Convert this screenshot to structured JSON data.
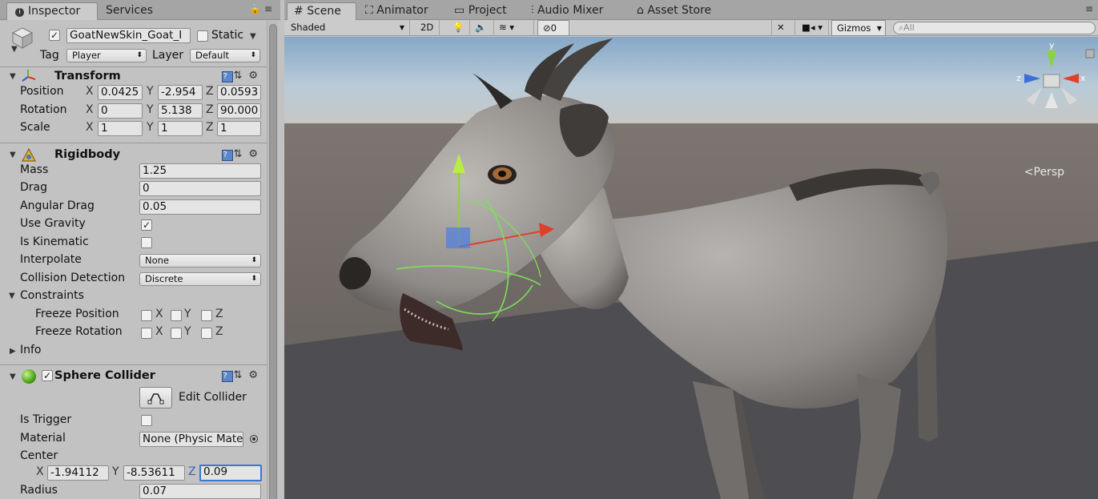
{
  "inspector": {
    "tabs": [
      {
        "label": "Inspector"
      },
      {
        "label": "Services"
      }
    ],
    "object": {
      "name": "GoatNewSkin_Goat_I",
      "static_label": "Static",
      "tag_label": "Tag",
      "tag_value": "Player",
      "layer_label": "Layer",
      "layer_value": "Default"
    },
    "transform": {
      "title": "Transform",
      "rows": [
        {
          "label": "Position",
          "x": "0.0425",
          "y": "-2.954",
          "z": "0.0593"
        },
        {
          "label": "Rotation",
          "x": "0",
          "y": "5.138",
          "z": "90.000"
        },
        {
          "label": "Scale",
          "x": "1",
          "y": "1",
          "z": "1"
        }
      ],
      "axes": [
        "X",
        "Y",
        "Z"
      ]
    },
    "rigidbody": {
      "title": "Rigidbody",
      "mass_label": "Mass",
      "mass": "1.25",
      "drag_label": "Drag",
      "drag": "0",
      "angular_drag_label": "Angular Drag",
      "angular_drag": "0.05",
      "use_gravity_label": "Use Gravity",
      "is_kinematic_label": "Is Kinematic",
      "interpolate_label": "Interpolate",
      "interpolate": "None",
      "collision_label": "Collision Detection",
      "collision": "Discrete",
      "constraints_label": "Constraints",
      "freeze_position_label": "Freeze Position",
      "freeze_rotation_label": "Freeze Rotation",
      "info_label": "Info"
    },
    "sphere_collider": {
      "title": "Sphere Collider",
      "edit_label": "Edit Collider",
      "is_trigger_label": "Is Trigger",
      "material_label": "Material",
      "material": "None (Physic Mate",
      "center_label": "Center",
      "center": {
        "x": "-1.94112",
        "y": "-8.53611",
        "z": "0.09"
      },
      "radius_label": "Radius",
      "radius": "0.07"
    }
  },
  "scene": {
    "tabs": [
      {
        "label": "Scene"
      },
      {
        "label": "Animator"
      },
      {
        "label": "Project"
      },
      {
        "label": "Audio Mixer"
      },
      {
        "label": "Asset Store"
      }
    ],
    "toolbar": {
      "shading": "Shaded",
      "mode_2d": "2D",
      "hidden_count": "0",
      "gizmos": "Gizmos",
      "search_placeholder": "All"
    },
    "persp_label": "Persp"
  },
  "colors": {
    "selection_blue": "#3c75d6",
    "gizmo_x": "#e0402a",
    "gizmo_y": "#8ad33c",
    "gizmo_z": "#3d6fd8"
  }
}
